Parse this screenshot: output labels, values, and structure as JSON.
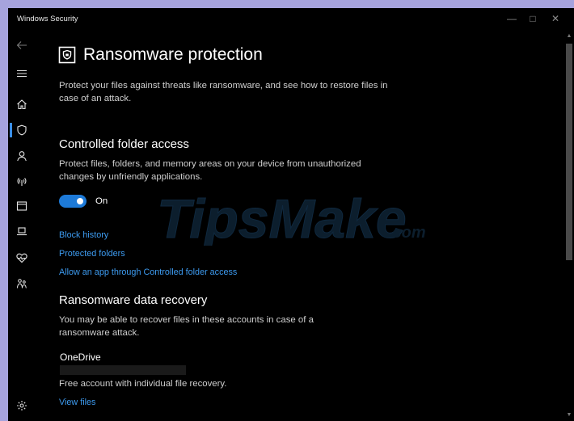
{
  "window": {
    "title": "Windows Security"
  },
  "sidebar": {
    "items": [
      {
        "icon": "back-arrow-icon"
      },
      {
        "icon": "hamburger-menu-icon"
      },
      {
        "icon": "home-icon"
      },
      {
        "icon": "shield-icon",
        "active": true
      },
      {
        "icon": "person-icon"
      },
      {
        "icon": "wifi-antenna-icon"
      },
      {
        "icon": "browser-window-icon"
      },
      {
        "icon": "laptop-icon"
      },
      {
        "icon": "heart-icon"
      },
      {
        "icon": "family-icon"
      },
      {
        "icon": "settings-gear-icon"
      }
    ]
  },
  "page": {
    "title": "Ransomware protection",
    "description": "Protect your files against threats like ransomware, and see how to restore files in case of an attack."
  },
  "controlled_folder_access": {
    "heading": "Controlled folder access",
    "description": "Protect files, folders, and memory areas on your device from unauthorized changes by unfriendly applications.",
    "toggle_state": "On",
    "toggle_on": true,
    "links": {
      "block_history": "Block history",
      "protected_folders": "Protected folders",
      "allow_app": "Allow an app through Controlled folder access"
    }
  },
  "ransomware_recovery": {
    "heading": "Ransomware data recovery",
    "description": "You may be able to recover files in these accounts in case of a ransomware attack.",
    "account_name": "OneDrive",
    "account_detail": "Free account with individual file recovery.",
    "view_files": "View files"
  },
  "watermark": {
    "brand": "TipsMake",
    "suffix": ".com"
  },
  "colors": {
    "accent": "#1d7ad8",
    "link": "#3d9bf0",
    "background": "#000000"
  }
}
